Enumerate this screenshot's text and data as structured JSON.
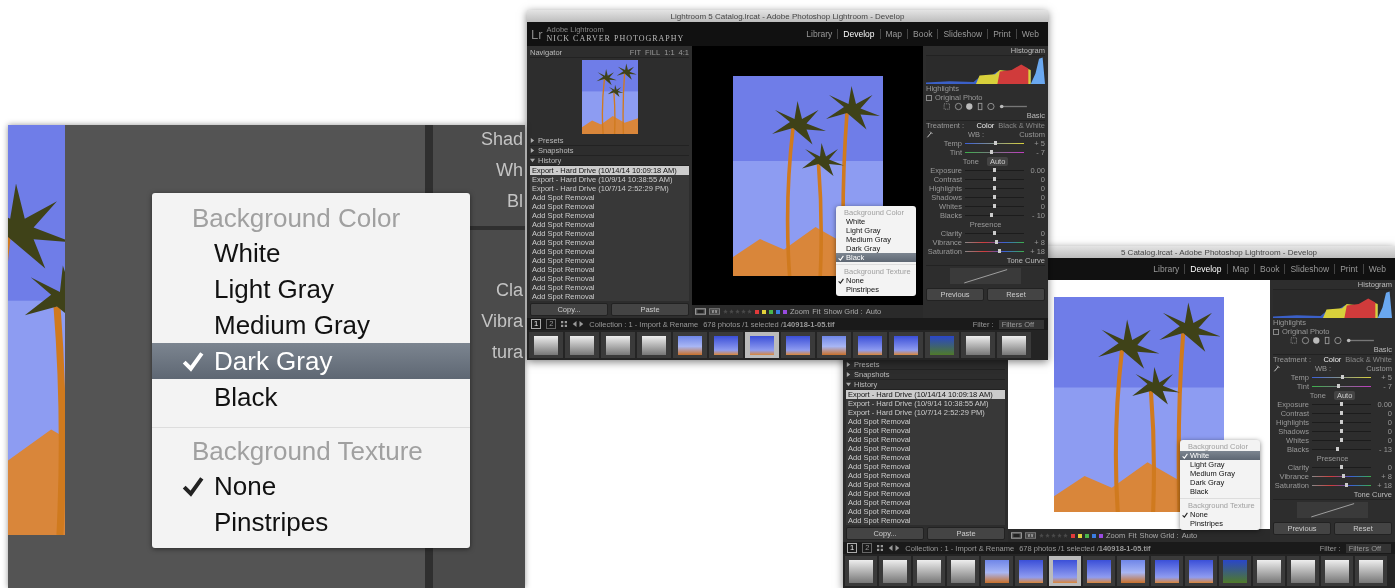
{
  "zoom_panel": {
    "side_groups": [
      [
        "Shad",
        "Wh",
        "Bl"
      ],
      [
        "Cla",
        "Vibra",
        "tura"
      ]
    ],
    "menu": {
      "sections": [
        {
          "heading": "Background Color",
          "items": [
            {
              "label": "White",
              "checked": false,
              "selected": false
            },
            {
              "label": "Light Gray",
              "checked": false,
              "selected": false
            },
            {
              "label": "Medium Gray",
              "checked": false,
              "selected": false
            },
            {
              "label": "Dark Gray",
              "checked": true,
              "selected": true
            },
            {
              "label": "Black",
              "checked": false,
              "selected": false
            }
          ]
        },
        {
          "heading": "Background Texture",
          "items": [
            {
              "label": "None",
              "checked": true,
              "selected": false
            },
            {
              "label": "Pinstripes",
              "checked": false,
              "selected": false
            }
          ]
        }
      ]
    }
  },
  "windows": [
    {
      "title": "Lightroom 5 Catalog.lrcat - Adobe Photoshop Lightroom - Develop",
      "brand": {
        "logo": "Lr",
        "product": "Adobe Lightroom",
        "name": "NICK CARVER PHOTOGRAPHY"
      },
      "nav": [
        {
          "label": "Library",
          "selected": false
        },
        {
          "label": "Develop",
          "selected": true
        },
        {
          "label": "Map",
          "selected": false
        },
        {
          "label": "Book",
          "selected": false
        },
        {
          "label": "Slideshow",
          "selected": false
        },
        {
          "label": "Print",
          "selected": false
        },
        {
          "label": "Web",
          "selected": false
        }
      ],
      "navigator": {
        "title": "Navigator",
        "zoom_options": [
          "FIT",
          "FILL",
          "1:1",
          "4:1"
        ]
      },
      "panels": [
        {
          "title": "Presets",
          "expanded": false
        },
        {
          "title": "Snapshots",
          "expanded": false
        },
        {
          "title": "History",
          "expanded": true
        }
      ],
      "history": [
        {
          "label": "Export - Hard Drive (10/14/14 10:09:18 AM)",
          "selected": true
        },
        {
          "label": "Export - Hard Drive (10/9/14 10:38:55 AM)",
          "selected": false
        },
        {
          "label": "Export - Hard Drive (10/7/14 2:52:29 PM)",
          "selected": false
        },
        {
          "label": "Add Spot Removal",
          "selected": false
        },
        {
          "label": "Add Spot Removal",
          "selected": false
        },
        {
          "label": "Add Spot Removal",
          "selected": false
        },
        {
          "label": "Add Spot Removal",
          "selected": false
        },
        {
          "label": "Add Spot Removal",
          "selected": false
        },
        {
          "label": "Add Spot Removal",
          "selected": false
        },
        {
          "label": "Add Spot Removal",
          "selected": false
        },
        {
          "label": "Add Spot Removal",
          "selected": false
        },
        {
          "label": "Add Spot Removal",
          "selected": false
        },
        {
          "label": "Add Spot Removal",
          "selected": false
        },
        {
          "label": "Add Spot Removal",
          "selected": false
        },
        {
          "label": "Add Spot Removal",
          "selected": false
        }
      ],
      "left_buttons": [
        "Copy...",
        "Paste"
      ],
      "canvas": {
        "kind": "black"
      },
      "toolbar": {
        "rating": {
          "stars": 0
        },
        "labels": [
          {
            "color": "#e03a3a"
          },
          {
            "color": "#e3d23a"
          },
          {
            "color": "#4bb64b"
          },
          {
            "color": "#3a7de0"
          },
          {
            "color": "#9a4be0"
          }
        ],
        "zoom_label": "Zoom",
        "zoom_value": "Fit",
        "grid_label": "Show Grid :",
        "grid_value": "Auto"
      },
      "menu": {
        "sections": [
          {
            "heading": "Background Color",
            "items": [
              {
                "label": "White",
                "checked": false,
                "selected": false
              },
              {
                "label": "Light Gray",
                "checked": false,
                "selected": false
              },
              {
                "label": "Medium Gray",
                "checked": false,
                "selected": false
              },
              {
                "label": "Dark Gray",
                "checked": false,
                "selected": false
              },
              {
                "label": "Black",
                "checked": true,
                "selected": true
              }
            ]
          },
          {
            "heading": "Background Texture",
            "items": [
              {
                "label": "None",
                "checked": true,
                "selected": false
              },
              {
                "label": "Pinstripes",
                "checked": false,
                "selected": false
              }
            ]
          }
        ]
      },
      "right": {
        "histogram_title": "Histogram",
        "highlights": "Highlights",
        "original_photo": {
          "label": "Original Photo",
          "checked": false
        },
        "basic_title": "Basic",
        "treatment_label": "Treatment :",
        "treatment_options": [
          {
            "label": "Color",
            "selected": true
          },
          {
            "label": "Black & White",
            "selected": false
          }
        ],
        "wb_label": "WB :",
        "wb_value": "Custom",
        "rows": [
          {
            "kind": "temp",
            "label": "Temp",
            "value": "+ 5",
            "level": 0.52
          },
          {
            "kind": "tint",
            "label": "Tint",
            "value": "- 7",
            "level": 0.45
          },
          {
            "kind": "group",
            "label": "Tone",
            "button": "Auto"
          },
          {
            "kind": "plain",
            "label": "Exposure",
            "value": "0.00",
            "level": 0.5
          },
          {
            "kind": "plain",
            "label": "Contrast",
            "value": "0",
            "level": 0.5
          },
          {
            "kind": "plain",
            "label": "Highlights",
            "value": "0",
            "level": 0.5
          },
          {
            "kind": "plain",
            "label": "Shadows",
            "value": "0",
            "level": 0.5
          },
          {
            "kind": "plain",
            "label": "Whites",
            "value": "0",
            "level": 0.5
          },
          {
            "kind": "plain",
            "label": "Blacks",
            "value": "- 10",
            "level": 0.45
          },
          {
            "kind": "group",
            "label": "Presence"
          },
          {
            "kind": "plain",
            "label": "Clarity",
            "value": "0",
            "level": 0.5
          },
          {
            "kind": "vibrance",
            "label": "Vibrance",
            "value": "+ 8",
            "level": 0.54
          },
          {
            "kind": "vibrance",
            "label": "Saturation",
            "value": "+ 18",
            "level": 0.59
          }
        ],
        "tone_curve": "Tone Curve",
        "buttons": [
          "Previous",
          "Reset"
        ]
      },
      "filmstrip": {
        "pages": [
          {
            "label": "1",
            "selected": true
          },
          {
            "label": "2",
            "selected": false
          }
        ],
        "collection": "Collection : 1 - Import & Rename",
        "count": "678 photos /1 selected /**140918-1-05.tif**",
        "filter_label": "Filter :",
        "filter_value": "Filters Off",
        "thumbs": [
          {
            "kind": "bw",
            "selected": false
          },
          {
            "kind": "bw",
            "selected": false
          },
          {
            "kind": "bw",
            "selected": false
          },
          {
            "kind": "bw",
            "selected": false
          },
          {
            "kind": "sunset",
            "selected": false
          },
          {
            "kind": "sky",
            "selected": false
          },
          {
            "kind": "sky",
            "selected": true
          },
          {
            "kind": "sky",
            "selected": false
          },
          {
            "kind": "sunset",
            "selected": false
          },
          {
            "kind": "sky",
            "selected": false
          },
          {
            "kind": "sky",
            "selected": false
          },
          {
            "kind": "palm",
            "selected": false
          },
          {
            "kind": "bw",
            "selected": false
          },
          {
            "kind": "bw",
            "selected": false
          }
        ]
      }
    },
    {
      "title": "5 Catalog.lrcat - Adobe Photoshop Lightroom - Develop",
      "nav": [
        {
          "label": "Library",
          "selected": false
        },
        {
          "label": "Develop",
          "selected": true
        },
        {
          "label": "Map",
          "selected": false
        },
        {
          "label": "Book",
          "selected": false
        },
        {
          "label": "Slideshow",
          "selected": false
        },
        {
          "label": "Print",
          "selected": false
        },
        {
          "label": "Web",
          "selected": false
        }
      ],
      "panels": [
        {
          "title": "Presets",
          "expanded": false
        },
        {
          "title": "Snapshots",
          "expanded": false
        },
        {
          "title": "History",
          "expanded": true
        }
      ],
      "history": [
        {
          "label": "Export - Hard Drive (10/14/14 10:09:18 AM)",
          "selected": true
        },
        {
          "label": "Export - Hard Drive (10/9/14 10:38:55 AM)",
          "selected": false
        },
        {
          "label": "Export - Hard Drive (10/7/14 2:52:29 PM)",
          "selected": false
        },
        {
          "label": "Add Spot Removal",
          "selected": false
        },
        {
          "label": "Add Spot Removal",
          "selected": false
        },
        {
          "label": "Add Spot Removal",
          "selected": false
        },
        {
          "label": "Add Spot Removal",
          "selected": false
        },
        {
          "label": "Add Spot Removal",
          "selected": false
        },
        {
          "label": "Add Spot Removal",
          "selected": false
        },
        {
          "label": "Add Spot Removal",
          "selected": false
        },
        {
          "label": "Add Spot Removal",
          "selected": false
        },
        {
          "label": "Add Spot Removal",
          "selected": false
        },
        {
          "label": "Add Spot Removal",
          "selected": false
        },
        {
          "label": "Add Spot Removal",
          "selected": false
        },
        {
          "label": "Add Spot Removal",
          "selected": false
        }
      ],
      "left_buttons": [
        "Copy...",
        "Paste"
      ],
      "canvas": {
        "kind": "white"
      },
      "toolbar": {
        "rating": {
          "stars": 0
        },
        "labels": [
          {
            "color": "#e03a3a"
          },
          {
            "color": "#e3d23a"
          },
          {
            "color": "#4bb64b"
          },
          {
            "color": "#3a7de0"
          },
          {
            "color": "#9a4be0"
          }
        ],
        "zoom_label": "Zoom",
        "zoom_value": "Fit",
        "grid_label": "Show Grid :",
        "grid_value": "Auto"
      },
      "menu": {
        "sections": [
          {
            "heading": "Background Color",
            "items": [
              {
                "label": "White",
                "checked": true,
                "selected": true
              },
              {
                "label": "Light Gray",
                "checked": false,
                "selected": false
              },
              {
                "label": "Medium Gray",
                "checked": false,
                "selected": false
              },
              {
                "label": "Dark Gray",
                "checked": false,
                "selected": false
              },
              {
                "label": "Black",
                "checked": false,
                "selected": false
              }
            ]
          },
          {
            "heading": "Background Texture",
            "items": [
              {
                "label": "None",
                "checked": true,
                "selected": false
              },
              {
                "label": "Pinstripes",
                "checked": false,
                "selected": false
              }
            ]
          }
        ]
      },
      "right": {
        "histogram_title": "Histogram",
        "highlights": "Highlights",
        "original_photo": {
          "label": "Original Photo",
          "checked": false
        },
        "basic_title": "Basic",
        "treatment_label": "Treatment :",
        "treatment_options": [
          {
            "label": "Color",
            "selected": true
          },
          {
            "label": "Black & White",
            "selected": false
          }
        ],
        "wb_label": "WB :",
        "wb_value": "Custom",
        "rows": [
          {
            "kind": "temp",
            "label": "Temp",
            "value": "+ 5",
            "level": 0.52
          },
          {
            "kind": "tint",
            "label": "Tint",
            "value": "- 7",
            "level": 0.45
          },
          {
            "kind": "group",
            "label": "Tone",
            "button": "Auto"
          },
          {
            "kind": "plain",
            "label": "Exposure",
            "value": "0.00",
            "level": 0.5
          },
          {
            "kind": "plain",
            "label": "Contrast",
            "value": "0",
            "level": 0.5
          },
          {
            "kind": "plain",
            "label": "Highlights",
            "value": "0",
            "level": 0.5
          },
          {
            "kind": "plain",
            "label": "Shadows",
            "value": "0",
            "level": 0.5
          },
          {
            "kind": "plain",
            "label": "Whites",
            "value": "0",
            "level": 0.5
          },
          {
            "kind": "plain",
            "label": "Blacks",
            "value": "- 13",
            "level": 0.44
          },
          {
            "kind": "group",
            "label": "Presence"
          },
          {
            "kind": "plain",
            "label": "Clarity",
            "value": "0",
            "level": 0.5
          },
          {
            "kind": "vibrance",
            "label": "Vibrance",
            "value": "+ 8",
            "level": 0.54
          },
          {
            "kind": "vibrance",
            "label": "Saturation",
            "value": "+ 18",
            "level": 0.59
          }
        ],
        "tone_curve": "Tone Curve",
        "buttons": [
          "Previous",
          "Reset"
        ]
      },
      "filmstrip": {
        "pages": [
          {
            "label": "1",
            "selected": true
          },
          {
            "label": "2",
            "selected": false
          }
        ],
        "collection": "Collection : 1 - Import & Rename",
        "count": "678 photos /1 selected /**140918-1-05.tif**",
        "filter_label": "Filter :",
        "filter_value": "Filters Off",
        "thumbs": [
          {
            "kind": "bw",
            "selected": false
          },
          {
            "kind": "bw",
            "selected": false
          },
          {
            "kind": "bw",
            "selected": false
          },
          {
            "kind": "bw",
            "selected": false
          },
          {
            "kind": "sunset",
            "selected": false
          },
          {
            "kind": "sky",
            "selected": false
          },
          {
            "kind": "sky",
            "selected": true
          },
          {
            "kind": "sky",
            "selected": false
          },
          {
            "kind": "sunset",
            "selected": false
          },
          {
            "kind": "sky",
            "selected": false
          },
          {
            "kind": "sky",
            "selected": false
          },
          {
            "kind": "palm",
            "selected": false
          },
          {
            "kind": "bw",
            "selected": false
          },
          {
            "kind": "bw",
            "selected": false
          },
          {
            "kind": "bw",
            "selected": false
          },
          {
            "kind": "bw",
            "selected": false
          }
        ]
      }
    }
  ]
}
